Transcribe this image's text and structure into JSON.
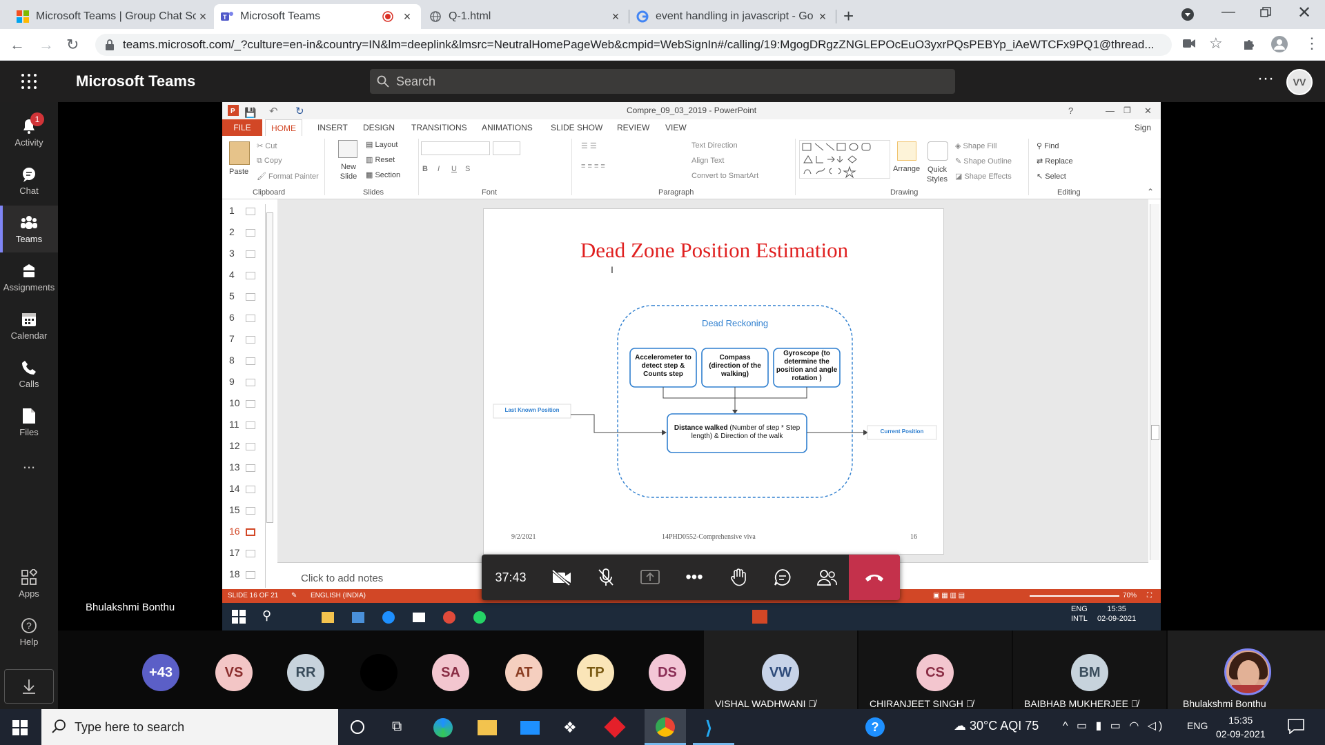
{
  "browser": {
    "tabs": [
      {
        "title": "Microsoft Teams | Group Chat Sc",
        "icon": "microsoft-logo-icon"
      },
      {
        "title": "Microsoft Teams",
        "icon": "teams-icon",
        "active": true,
        "recording": true
      },
      {
        "title": "Q-1.html",
        "icon": "globe-icon"
      },
      {
        "title": "event handling in javascript - Go",
        "icon": "google-icon"
      }
    ],
    "url": "teams.microsoft.com/_?culture=en-in&country=IN&lm=deeplink&lmsrc=NeutralHomePageWeb&cmpid=WebSignIn#/calling/19:MgogDRgzZNGLEPOcEuO3yxrPQsPEBYp_iAeWTCFx9PQ1@thread..."
  },
  "teams": {
    "app_title": "Microsoft Teams",
    "search_placeholder": "Search",
    "user_initials": "VV",
    "rail": [
      {
        "label": "Activity",
        "badge": "1"
      },
      {
        "label": "Chat"
      },
      {
        "label": "Teams",
        "selected": true
      },
      {
        "label": "Assignments"
      },
      {
        "label": "Calendar"
      },
      {
        "label": "Calls"
      },
      {
        "label": "Files"
      },
      {
        "label": "..."
      },
      {
        "label": "Apps"
      },
      {
        "label": "Help"
      }
    ],
    "presenter_name": "Bhulakshmi Bonthu"
  },
  "powerpoint": {
    "window_title": "Compre_09_03_2019 - PowerPoint",
    "sign_in": "Sign in",
    "tabs": [
      "FILE",
      "HOME",
      "INSERT",
      "DESIGN",
      "TRANSITIONS",
      "ANIMATIONS",
      "SLIDE SHOW",
      "REVIEW",
      "VIEW"
    ],
    "active_tab": "HOME",
    "ribbon": {
      "clipboard": {
        "paste": "Paste",
        "cut": "Cut",
        "copy": "Copy",
        "format_painter": "Format Painter",
        "label": "Clipboard"
      },
      "slides": {
        "new_slide": "New Slide",
        "layout": "Layout",
        "reset": "Reset",
        "section": "Section",
        "label": "Slides"
      },
      "font": {
        "label": "Font"
      },
      "paragraph": {
        "text_direction": "Text Direction",
        "align_text": "Align Text",
        "smartart": "Convert to SmartArt",
        "label": "Paragraph"
      },
      "drawing": {
        "arrange": "Arrange",
        "quick_styles": "Quick Styles",
        "shape_fill": "Shape Fill",
        "shape_outline": "Shape Outline",
        "shape_effects": "Shape Effects",
        "label": "Drawing"
      },
      "editing": {
        "find": "Find",
        "replace": "Replace",
        "select": "Select",
        "label": "Editing"
      }
    },
    "slide_numbers": [
      "1",
      "2",
      "3",
      "4",
      "5",
      "6",
      "7",
      "8",
      "9",
      "10",
      "11",
      "12",
      "13",
      "14",
      "15",
      "16",
      "17",
      "18"
    ],
    "current_slide_index": 16,
    "slide": {
      "title": "Dead Zone Position Estimation",
      "group_label": "Dead Reckoning",
      "box_accelerometer": "Accelerometer to detect step & Counts step",
      "box_compass": "Compass (direction of the walking)",
      "box_gyroscope": "Gyroscope (to determine the position and angle rotation )",
      "last_known": "Last Known Position",
      "distance_bold": "Distance walked",
      "distance_rest": " (Number of step * Step length) & Direction of the walk",
      "current_position": "Current Position",
      "footer_date": "9/2/2021",
      "footer_center": "14PHD0552-Comprehensive viva",
      "footer_page": "16"
    },
    "notes_placeholder": "Click to add notes",
    "status_slide": "SLIDE 16 OF 21",
    "status_lang": "ENGLISH (INDIA)",
    "zoom": "70%",
    "win7_time": "15:35",
    "win7_date": "02-09-2021",
    "win7_lang": "ENG",
    "win7_layout": "INTL"
  },
  "call": {
    "timer": "37:43",
    "colors": {
      "hangup": "#c4314b"
    }
  },
  "participants": {
    "overflow": "+43",
    "avatars": [
      {
        "initials": "VS",
        "bg": "#f3c6c6",
        "fg": "#8a2d2d"
      },
      {
        "initials": "RR",
        "bg": "#c7d3dc",
        "fg": "#3a4d5c"
      },
      {
        "initials": "",
        "bg": "#000000",
        "fg": "#000000"
      },
      {
        "initials": "SA",
        "bg": "#f3c6cf",
        "fg": "#8a2d45"
      },
      {
        "initials": "AT",
        "bg": "#f5cfbf",
        "fg": "#8a3d22"
      },
      {
        "initials": "TP",
        "bg": "#fae5b8",
        "fg": "#7a5a12"
      },
      {
        "initials": "DS",
        "bg": "#f3c6d6",
        "fg": "#8a2d55"
      }
    ],
    "named": [
      {
        "initials": "VW",
        "name": "VISHAL WADHWANI",
        "bg": "#c7d3e8",
        "fg": "#2d4a7a"
      },
      {
        "initials": "CS",
        "name": "CHIRANJEET SINGH",
        "bg": "#f3c6cf",
        "fg": "#8a2d45"
      },
      {
        "initials": "BM",
        "name": "BAIBHAB MUKHERJEE",
        "bg": "#c7d3dc",
        "fg": "#3a4d5c"
      },
      {
        "initials": "",
        "name": "Bhulakshmi Bonthu",
        "photo": true
      }
    ]
  },
  "windows": {
    "search_placeholder": "Type here to search",
    "weather": "30°C  AQI 75",
    "lang": "ENG",
    "time": "15:35",
    "date": "02-09-2021"
  }
}
